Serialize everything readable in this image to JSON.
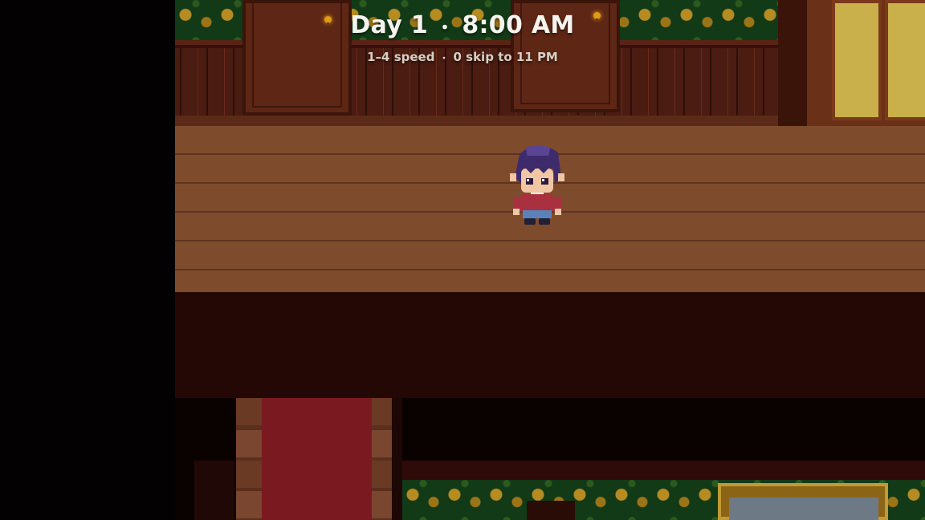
{
  "hud": {
    "day": "Day 1",
    "separator": "・",
    "time": "8:00 AM",
    "speed_hint": "1–4 speed",
    "skip_hint": "0 skip to 11 PM"
  },
  "colors": {
    "wallpaper": "#123a17",
    "rose_gold": "#b58b22",
    "wood_floor": "#7c4a2c",
    "dark_void": "#030101",
    "runner_red": "#7a1a20",
    "hud_text": "#f5f3ee"
  }
}
